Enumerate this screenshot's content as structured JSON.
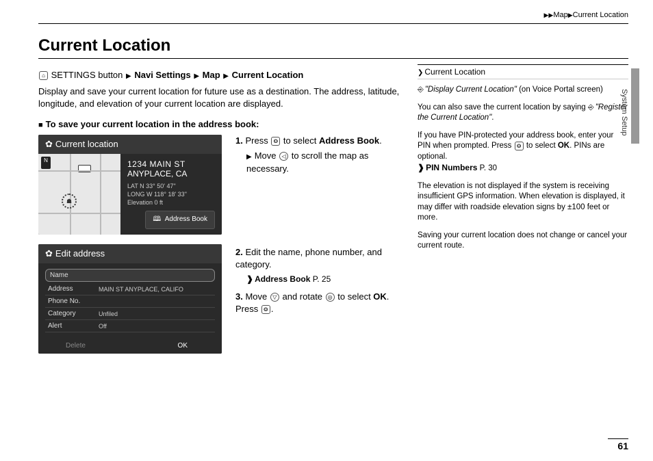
{
  "breadcrumb": {
    "parts": [
      "Map",
      "Current Location"
    ]
  },
  "title": "Current Location",
  "nav_path": {
    "prefix": "SETTINGS button",
    "steps": [
      "Navi Settings",
      "Map",
      "Current Location"
    ]
  },
  "intro": "Display and save your current location for future use as a destination. The address, latitude, longitude, and elevation of your current location are displayed.",
  "subhead": "To save your current location in the address book:",
  "screenshot1": {
    "title": "Current location",
    "compass": "N",
    "route_number": "105",
    "addr_line1": "1234 MAIN ST",
    "addr_line2": "ANYPLACE, CA",
    "lat": "LAT   N 33° 50' 47\"",
    "long": "LONG  W 118° 18' 33\"",
    "elev": "Elevation  0 ft",
    "button": "Address Book"
  },
  "screenshot2": {
    "title": "Edit address",
    "rows": [
      {
        "label": "Name",
        "value": ""
      },
      {
        "label": "Address",
        "value": "MAIN ST ANYPLACE, CALIFO"
      },
      {
        "label": "Phone No.",
        "value": ""
      },
      {
        "label": "Category",
        "value": "Unfiled"
      },
      {
        "label": "Alert",
        "value": "Off"
      }
    ],
    "footer": {
      "delete": "Delete",
      "ok": "OK"
    }
  },
  "steps": {
    "s1_a": "Press ",
    "s1_b": " to select ",
    "s1_bold": "Address Book",
    "s1_c": ".",
    "s1_sub_a": "Move ",
    "s1_sub_b": " to scroll the map as necessary.",
    "s2": "Edit the name, phone number, and category.",
    "s2_xref_label": "Address Book",
    "s2_xref_page": "P. 25",
    "s3_a": "Move ",
    "s3_b": " and rotate ",
    "s3_c": " to select ",
    "s3_bold": "OK",
    "s3_d": ". Press ",
    "s3_e": "."
  },
  "sidenote": {
    "heading": "Current Location",
    "p1_voice": "\"Display Current Location\"",
    "p1_rest": " (on Voice Portal screen)",
    "p2_a": "You can also save the current location by saying ",
    "p2_voice": "\"Register the Current Location\"",
    "p2_b": ".",
    "p3_a": "If you have PIN-protected your address book, enter your PIN when prompted. Press ",
    "p3_b": " to select ",
    "p3_bold": "OK",
    "p3_c": ". PINs are optional.",
    "p3_xref_label": "PIN Numbers",
    "p3_xref_page": "P. 30",
    "p4": "The elevation is not displayed if the system is receiving insufficient GPS information. When elevation is displayed, it may differ with roadside elevation signs by ±100 feet or more.",
    "p5": "Saving your current location does not change or cancel your current route."
  },
  "side_label": "System Setup",
  "page_number": "61"
}
